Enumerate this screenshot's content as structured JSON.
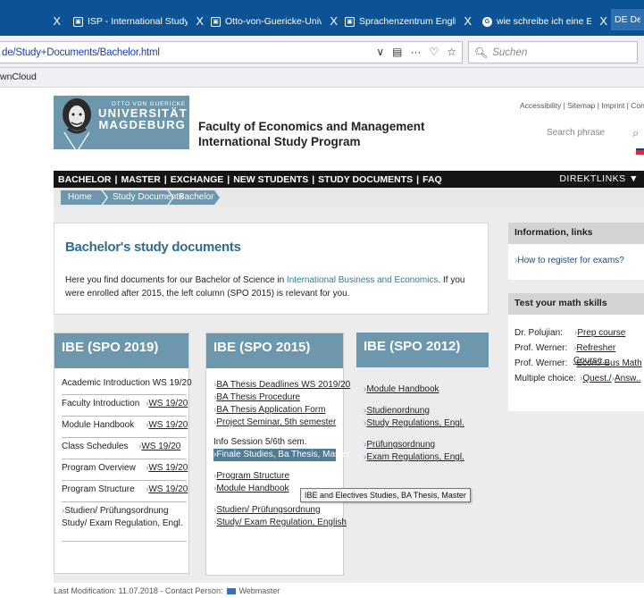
{
  "browser": {
    "tabs": [
      {
        "label": "",
        "close": "X",
        "icon": "tab-close-icon"
      },
      {
        "label": "ISP - International Study Progr",
        "close": "X",
        "icon": "favicon-icon"
      },
      {
        "label": "Otto-von-Guericke-Universität",
        "close": "X",
        "icon": "favicon-icon"
      },
      {
        "label": "Sprachenzentrum Englisch (UN",
        "close": "X",
        "icon": "favicon-icon"
      },
      {
        "label": "wie schreibe ich eine Email Stu",
        "close": "X",
        "icon": "google-icon"
      },
      {
        "label": "DE Deut",
        "close": "",
        "icon": ""
      }
    ],
    "url": "de/Study+Documents/Bachelor.html",
    "url_icons": [
      "∨",
      "▤",
      "···",
      "♡",
      "☆"
    ],
    "search_placeholder": "Suchen",
    "bookmark": "wnCloud"
  },
  "header": {
    "logo_small": "OTTO VON GUERICKE",
    "logo_line1": "UNIVERSITÄT",
    "logo_line2": "MAGDEBURG",
    "faculty_line1": "Faculty of Economics and Management",
    "faculty_line2": "International Study Program",
    "util_links": "Accessibility | Sitemap | Imprint | Contact",
    "search_placeholder": "Search phrase"
  },
  "mainnav": {
    "items": [
      "BACHELOR",
      "MASTER",
      "EXCHANGE",
      "NEW STUDENTS",
      "STUDY DOCUMENTS",
      "FAQ"
    ],
    "separator": "|",
    "direktlinks": "DIREKTLINKS ▼"
  },
  "breadcrumb": [
    "Home",
    "Study Documents",
    "Bachelor"
  ],
  "intro": {
    "title": "Bachelor's study documents",
    "text_before": "Here you find documents for our Bachelor of Science in ",
    "text_highlight": "International Business and Economics",
    "text_after": ". If you were enrolled after 2015, the left column (SPO 2015) is relevant for you."
  },
  "columns": {
    "spo2019": {
      "title": "IBE (SPO 2019)",
      "rows": [
        {
          "label": "Academic Introduction WS 19/20",
          "link": ""
        },
        {
          "label": "Faculty Introduction",
          "link": "WS 19/20"
        },
        {
          "label": "Module Handbook",
          "link": "WS 19/20"
        },
        {
          "label": "Class Schedules",
          "link": "WS 19/20"
        },
        {
          "label": "Program Overview",
          "link": "WS 19/20"
        },
        {
          "label": "Program Structure",
          "link": "WS 19/20"
        }
      ],
      "extra_line1": "Studien/ Prüfungsordnung",
      "extra_line2": "Study/ Exam Regulation, Engl."
    },
    "spo2015": {
      "title": "IBE (SPO 2015)",
      "links": [
        "BA Thesis Deadlines WS 2019/20",
        "BA Thesis Procedure",
        "BA Thesis Application Form",
        "Project Seminar, 5th semester"
      ],
      "info": "Info  Session 5/6th sem.",
      "highlight_link": "Finale Studies, Ba Thesis, Master",
      "links2": [
        "Program Structure",
        "Module Handbook"
      ],
      "links3": [
        "Studien/ Prüfungsordnung",
        "Study/ Exam Regulation, English"
      ]
    },
    "spo2012": {
      "title": "IBE (SPO 2012)",
      "links": [
        "Module Handbook"
      ],
      "links2": [
        "Studienordnung",
        "Study Regulations, Engl."
      ],
      "links3": [
        "Prüfungsordnung",
        "Exam Regulations, Engl."
      ]
    }
  },
  "tooltip": "IBE and Electives Studies, BA Thesis, Master",
  "sidebar": {
    "info_title": "Information, links",
    "info_link": "How to register for exams?",
    "math_title": "Test your math skills",
    "math_rows": [
      {
        "label": "Dr. Polujian:",
        "link": "Prep course"
      },
      {
        "label": "Prof. Werner:",
        "link": "Refresher Course..."
      },
      {
        "label": "Prof. Werner:",
        "link": "Econ./ Bus Math"
      },
      {
        "label": "Multiple choice:",
        "link": "Quest./",
        "link2": "Answ.."
      }
    ]
  },
  "footer": {
    "text": "Last Modification: 11.07.2018 - Contact Person:",
    "webmaster": "Webmaster"
  },
  "colors": {
    "browser_blue": "#0b5394",
    "accent": "#6c97ad",
    "nav_black": "#151515",
    "title_blue": "#2f6c8f",
    "highlight": "#4f7d96"
  }
}
